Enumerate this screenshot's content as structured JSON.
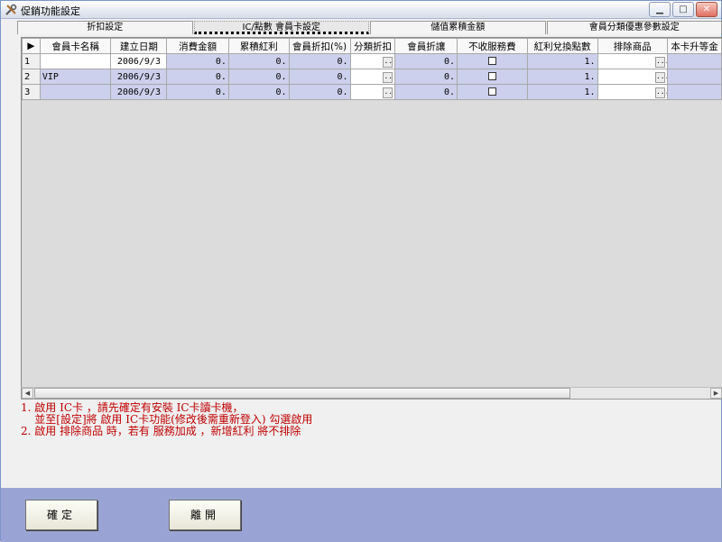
{
  "window": {
    "title": "促銷功能設定"
  },
  "tabs": [
    "折扣設定",
    "IC/點數 會員卡設定",
    "儲值累積金額",
    "會員分類優惠參數設定"
  ],
  "grid": {
    "columns": [
      "會員卡名稱",
      "建立日期",
      "消費金額",
      "累積紅利",
      "會員折扣(%)",
      "分類折扣",
      "會員折讓",
      "不收服務費",
      "紅利兌換點數",
      "排除商品",
      "本卡升等金"
    ],
    "rows": [
      {
        "num": "1",
        "name": "",
        "date": "2006/9/3",
        "spend": "0.",
        "bonus": "0.",
        "discount": "0.",
        "cat": "...",
        "rebate": "0.",
        "nofee": "",
        "redeem": "1.",
        "exclude": "..."
      },
      {
        "num": "2",
        "name": "VIP",
        "date": "2006/9/3",
        "spend": "0.",
        "bonus": "0.",
        "discount": "0.",
        "cat": "...",
        "rebate": "0.",
        "nofee": "",
        "redeem": "1.",
        "exclude": "..."
      },
      {
        "num": "3",
        "name": "",
        "date": "2006/9/3",
        "spend": "0.",
        "bonus": "0.",
        "discount": "0.",
        "cat": "...",
        "rebate": "0.",
        "nofee": "",
        "redeem": "1.",
        "exclude": "..."
      }
    ]
  },
  "notes": [
    "1. 啟用 IC卡 ，請先確定有安裝 IC卡讀卡機，",
    "    並至[設定]將 啟用 IC卡功能(修改後需重新登入) 勾選啟用",
    "2. 啟用 排除商品 時，若有 服務加成 ，新增紅利 將不排除"
  ],
  "buttons": {
    "confirm": "確定",
    "leave": "離開"
  },
  "colors": {
    "row_bg": "#ccd0ec",
    "note_red": "#c00000",
    "bottom_bar": "#9aa4d4"
  }
}
